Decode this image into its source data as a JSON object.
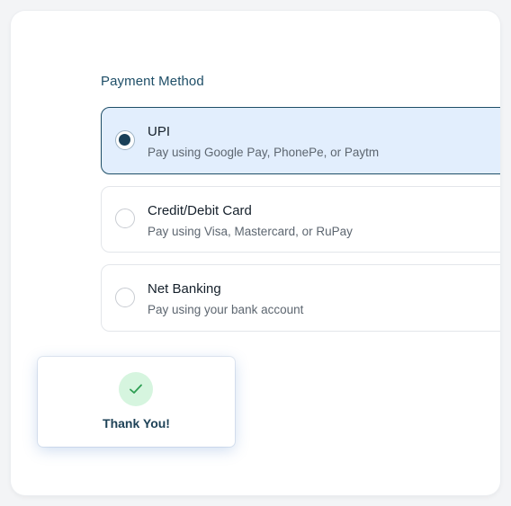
{
  "payment": {
    "section_title": "Payment Method",
    "options": [
      {
        "title": "UPI",
        "description": "Pay using Google Pay, PhonePe, or Paytm",
        "selected": true
      },
      {
        "title": "Credit/Debit Card",
        "description": "Pay using Visa, Mastercard, or RuPay",
        "selected": false
      },
      {
        "title": "Net Banking",
        "description": "Pay using your bank account",
        "selected": false
      }
    ]
  },
  "toast": {
    "message": "Thank You!",
    "icon": "check-icon"
  },
  "colors": {
    "accent": "#1a4058",
    "selected_bg": "#e2eefd",
    "success_bg": "#d6f5df",
    "success_check": "#2e9e53"
  }
}
